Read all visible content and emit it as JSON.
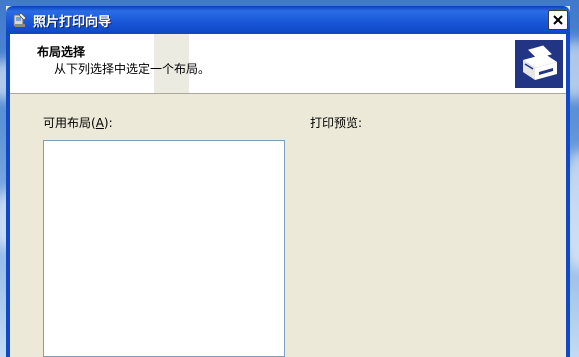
{
  "window": {
    "title": "照片打印向导",
    "title_icon": "wizard-icon",
    "close_icon": "close-icon"
  },
  "header": {
    "title": "布局选择",
    "subtitle": "从下列选择中选定一个布局。",
    "logo_icon": "printer-icon",
    "logo_color": "#213584"
  },
  "content": {
    "available_layouts_label_prefix": "可用布局(",
    "available_layouts_label_key": "A",
    "available_layouts_label_suffix": "):",
    "print_preview_label": "打印预览:"
  },
  "colors": {
    "title_bar": "#0e47c4",
    "window_bg": "#ece9d8",
    "header_bg": "#ffffff",
    "list_border": "#7f9db9"
  }
}
